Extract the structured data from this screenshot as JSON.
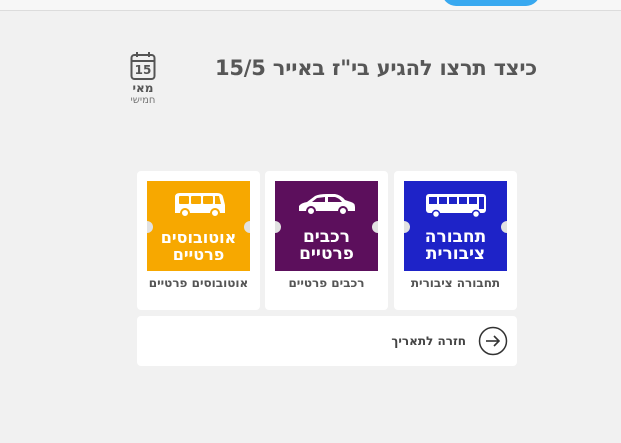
{
  "header": {
    "title": "כיצד תרצו להגיע בי\"ז באייר 15/5"
  },
  "date": {
    "day": "15",
    "month": "מאי",
    "weekday": "חמישי"
  },
  "options": [
    {
      "id": "public",
      "image_text_line1": "תחבורה",
      "image_text_line2": "ציבורית",
      "label": "תחבורה ציבורית",
      "color": "#1e23c8",
      "icon": "bus-icon"
    },
    {
      "id": "private-cars",
      "image_text_line1": "רכבים",
      "image_text_line2": "פרטיים",
      "label": "רכבים פרטיים",
      "color": "#5c0f5c",
      "icon": "car-icon"
    },
    {
      "id": "private-buses",
      "image_text_line1": "אוטובוסים",
      "image_text_line2": "פרטיים",
      "label": "אוטובוסים פרטיים",
      "color": "#f7a800",
      "icon": "van-icon"
    }
  ],
  "back": {
    "label": "חזרה לתאריך",
    "icon": "arrow-right-icon"
  },
  "colors": {
    "background": "#f1f1f1",
    "accent": "#39a9f0"
  }
}
